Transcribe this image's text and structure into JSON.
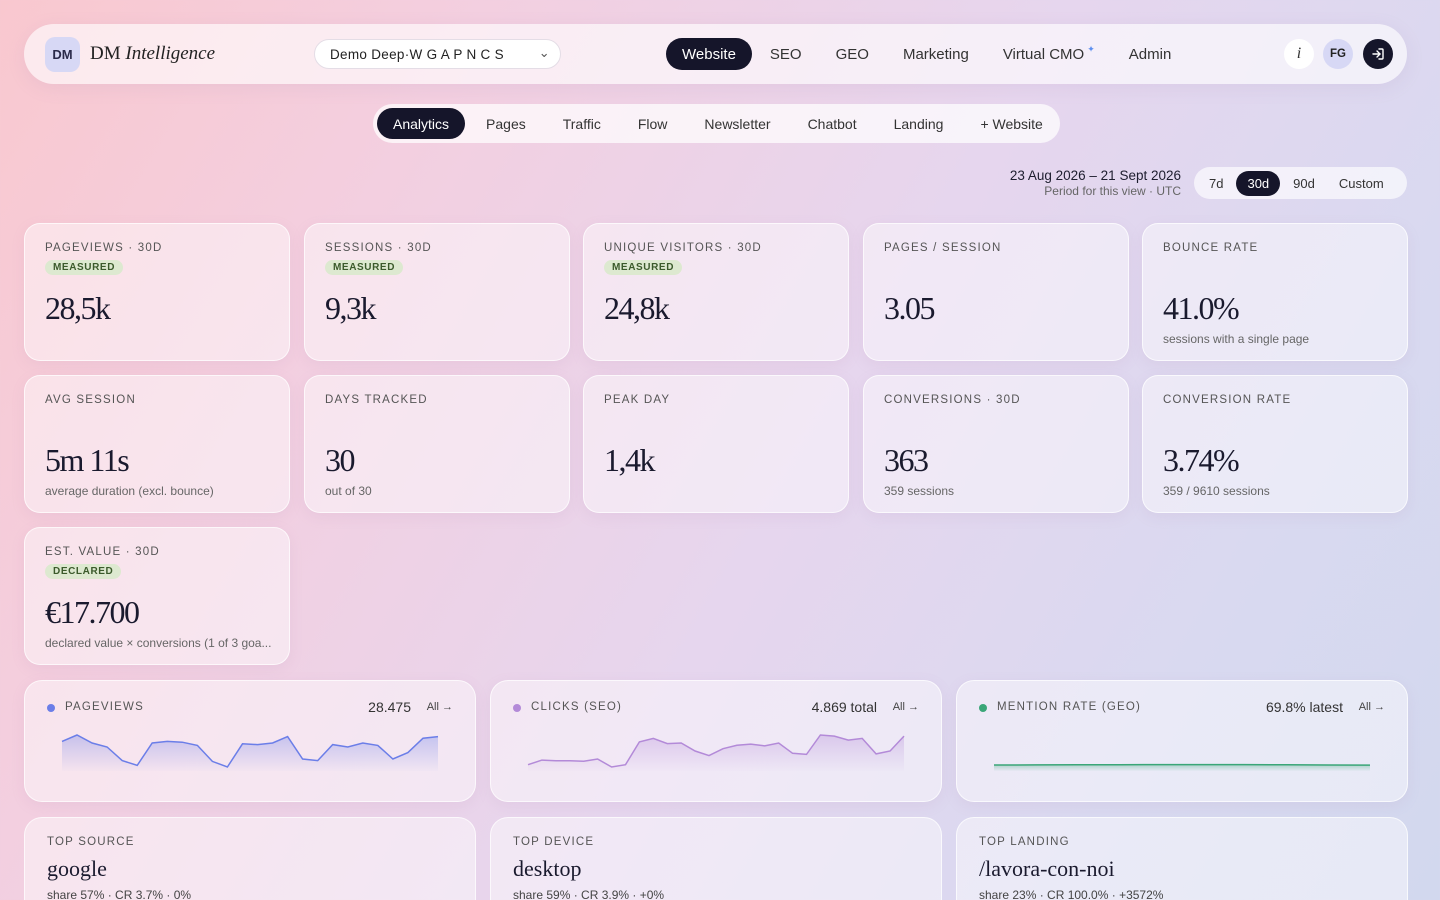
{
  "brand": {
    "initials": "DM",
    "name_main": "DM",
    "name_italic": "Intelligence"
  },
  "project": {
    "selected": "Demo Deep·W G A P N C S"
  },
  "main_nav": [
    {
      "label": "Website",
      "active": true
    },
    {
      "label": "SEO"
    },
    {
      "label": "GEO"
    },
    {
      "label": "Marketing"
    },
    {
      "label": "Virtual CMO"
    },
    {
      "label": "Admin"
    }
  ],
  "header_actions": {
    "info": "i",
    "avatar": "FG"
  },
  "sub_nav": [
    {
      "label": "Analytics",
      "active": true
    },
    {
      "label": "Pages"
    },
    {
      "label": "Traffic"
    },
    {
      "label": "Flow"
    },
    {
      "label": "Newsletter"
    },
    {
      "label": "Chatbot"
    },
    {
      "label": "Landing"
    },
    {
      "label": "+ Website"
    }
  ],
  "period": {
    "range": "23 Aug 2026 – 21 Sept 2026",
    "sub": "Period for this view · UTC"
  },
  "range_tabs": [
    {
      "label": "7d"
    },
    {
      "label": "30d",
      "active": true
    },
    {
      "label": "90d"
    },
    {
      "label": "Custom"
    }
  ],
  "kpis": [
    {
      "label": "PAGEVIEWS · 30D",
      "badge": "MEASURED",
      "value": "28,5k",
      "note": ""
    },
    {
      "label": "SESSIONS · 30D",
      "badge": "MEASURED",
      "value": "9,3k",
      "note": ""
    },
    {
      "label": "UNIQUE VISITORS · 30D",
      "badge": "MEASURED",
      "value": "24,8k",
      "note": ""
    },
    {
      "label": "PAGES / SESSION",
      "badge": "",
      "value": "3.05",
      "note": ""
    },
    {
      "label": "BOUNCE RATE",
      "badge": "",
      "value": "41.0%",
      "note": "sessions with a single page"
    },
    {
      "label": "AVG SESSION",
      "badge": "",
      "value": "5m 11s",
      "note": "average duration (excl. bounce)"
    },
    {
      "label": "DAYS TRACKED",
      "badge": "",
      "value": "30",
      "note": "out of 30"
    },
    {
      "label": "PEAK DAY",
      "badge": "",
      "value": "1,4k",
      "note": ""
    },
    {
      "label": "CONVERSIONS · 30D",
      "badge": "",
      "value": "363",
      "note": "359 sessions"
    },
    {
      "label": "CONVERSION RATE",
      "badge": "",
      "value": "3.74%",
      "note": "359 / 9610 sessions"
    },
    {
      "label": "EST. VALUE · 30D",
      "badge": "DECLARED",
      "value": "€17.700",
      "note": "declared value × conversions (1 of 3 goa..."
    }
  ],
  "sparks": [
    {
      "title": "PAGEVIEWS",
      "value": "28.475",
      "all": "All →",
      "color": "#6b7ee8",
      "points": [
        62,
        70,
        60,
        55,
        38,
        32,
        60,
        62,
        61,
        57,
        37,
        30,
        59,
        58,
        60,
        68,
        40,
        38,
        58,
        55,
        60,
        57,
        40,
        48,
        66,
        68
      ]
    },
    {
      "title": "CLICKS (SEO)",
      "value": "4.869 total",
      "all": "All →",
      "color": "#b38ad8",
      "points": [
        12,
        20,
        19,
        19,
        18,
        22,
        8,
        12,
        52,
        58,
        49,
        50,
        36,
        28,
        40,
        46,
        48,
        45,
        50,
        32,
        30,
        64,
        62,
        55,
        58,
        31,
        36,
        62
      ]
    },
    {
      "title": "MENTION RATE (GEO)",
      "value": "69.8% latest",
      "all": "All →",
      "color": "#3aa678",
      "points": [
        70.0,
        70.2,
        70.5,
        70.8,
        71.0,
        71.1,
        71.0,
        70.5,
        70.1,
        69.8
      ]
    }
  ],
  "bottom_cards": [
    {
      "label": "TOP SOURCE",
      "value": "google",
      "meta": "share 57%  ·  CR 3.7%  ·  0%"
    },
    {
      "label": "TOP DEVICE",
      "value": "desktop",
      "meta": "share 59%  ·  CR 3.9%  ·  +0%"
    },
    {
      "label": "TOP LANDING",
      "value": "/lavora-con-noi",
      "meta": "share 23%  ·  CR 100.0%  ·  +3572%"
    }
  ]
}
